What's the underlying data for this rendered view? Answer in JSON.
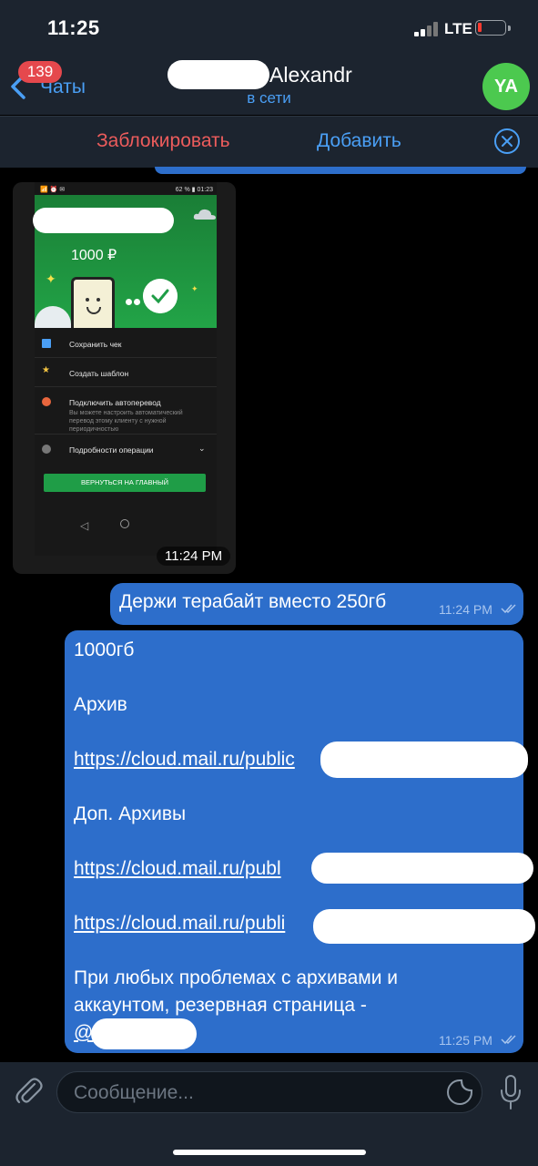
{
  "status_bar": {
    "time": "11:25",
    "network": "LTE"
  },
  "header": {
    "back_label": "Чаты",
    "unread_count": "139",
    "contact_name": "Alexandr",
    "contact_status": "в сети",
    "avatar_initials": "YA"
  },
  "action_bar": {
    "block_label": "Заблокировать",
    "add_label": "Добавить"
  },
  "image_message": {
    "time": "11:24 PM",
    "screenshot": {
      "status_left": "📶 ⏰ ✉",
      "status_right": "62 % ▮ 01:23",
      "amount": "1000 ₽",
      "menu": [
        {
          "label": "Сохранить чек"
        },
        {
          "label": "Создать шаблон"
        },
        {
          "label": "Подключить автоперевод",
          "sub": "Вы можете настроить автоматический перевод этому клиенту с нужной периодичностью"
        },
        {
          "label": "Подробности операции"
        }
      ],
      "return_button": "ВЕРНУТЬСЯ НА ГЛАВНЫЙ"
    }
  },
  "messages": [
    {
      "text": "Держи терабайт вместо 250гб",
      "time": "11:24 PM"
    },
    {
      "lines": [
        "1000гб",
        "Архив",
        "https://cloud.mail.ru/public",
        "Доп. Архивы",
        "https://cloud.mail.ru/publ",
        "https://cloud.mail.ru/publi",
        "При любых проблемах с архивами и",
        "аккаунтом, резервная страница -",
        "@"
      ],
      "time": "11:25 PM"
    }
  ],
  "input": {
    "placeholder": "Сообщение..."
  },
  "colors": {
    "accent": "#4a9ff5",
    "bubble": "#2d6ecb",
    "danger": "#ec5c5c",
    "avatar": "#4cc94f",
    "badge": "#e5484d"
  }
}
